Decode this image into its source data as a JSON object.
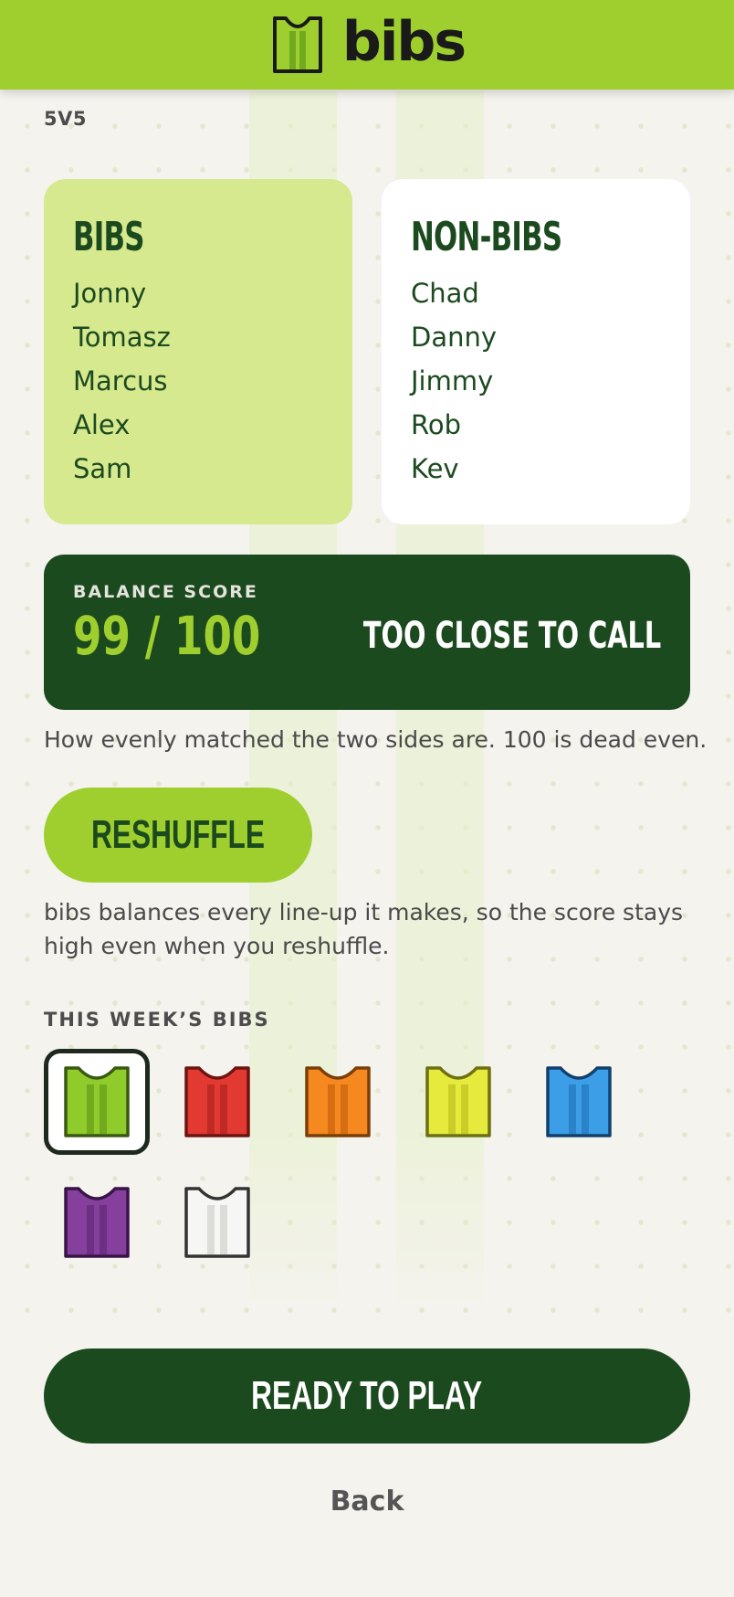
{
  "header": {
    "logo_text": "bibs"
  },
  "format": "5V5",
  "teams": {
    "bibs": {
      "title": "BIBS",
      "players": [
        "Jonny",
        "Tomasz",
        "Marcus",
        "Alex",
        "Sam"
      ]
    },
    "nonbibs": {
      "title": "NON-BIBS",
      "players": [
        "Chad",
        "Danny",
        "Jimmy",
        "Rob",
        "Kev"
      ]
    }
  },
  "score": {
    "label": "BALANCE SCORE",
    "value": "99 / 100",
    "verdict": "TOO CLOSE TO CALL",
    "help": "How evenly matched the two sides are. 100 is dead even."
  },
  "reshuffle": {
    "label": "RESHUFFLE",
    "note": "bibs balances every line-up it makes, so the score stays high even when you reshuffle."
  },
  "bib_colors": {
    "label": "THIS WEEK’S BIBS",
    "selected": "green",
    "options": [
      {
        "name": "green",
        "fill": "#8fcb2a",
        "stripe": "#6fab1c",
        "stroke": "#3a5a12"
      },
      {
        "name": "red",
        "fill": "#e23a32",
        "stripe": "#c02a24",
        "stroke": "#6e1410"
      },
      {
        "name": "orange",
        "fill": "#f5891f",
        "stripe": "#d66d10",
        "stroke": "#7a3e08"
      },
      {
        "name": "yellow",
        "fill": "#e6ea3c",
        "stripe": "#c9cd26",
        "stroke": "#6d6f12"
      },
      {
        "name": "blue",
        "fill": "#3b9ee6",
        "stripe": "#2a82c8",
        "stroke": "#12406c"
      },
      {
        "name": "purple",
        "fill": "#84409c",
        "stripe": "#6c2f84",
        "stroke": "#3a1448"
      },
      {
        "name": "white",
        "fill": "#f6f6f4",
        "stripe": "#dcdcd8",
        "stroke": "#333333"
      }
    ]
  },
  "actions": {
    "ready_label": "READY TO PLAY",
    "back_label": "Back"
  },
  "colors": {
    "brand_green": "#9ecf2e",
    "dark_green": "#1c4a1f",
    "bibs_card": "#d6e98f",
    "background": "#f4f3ee"
  }
}
